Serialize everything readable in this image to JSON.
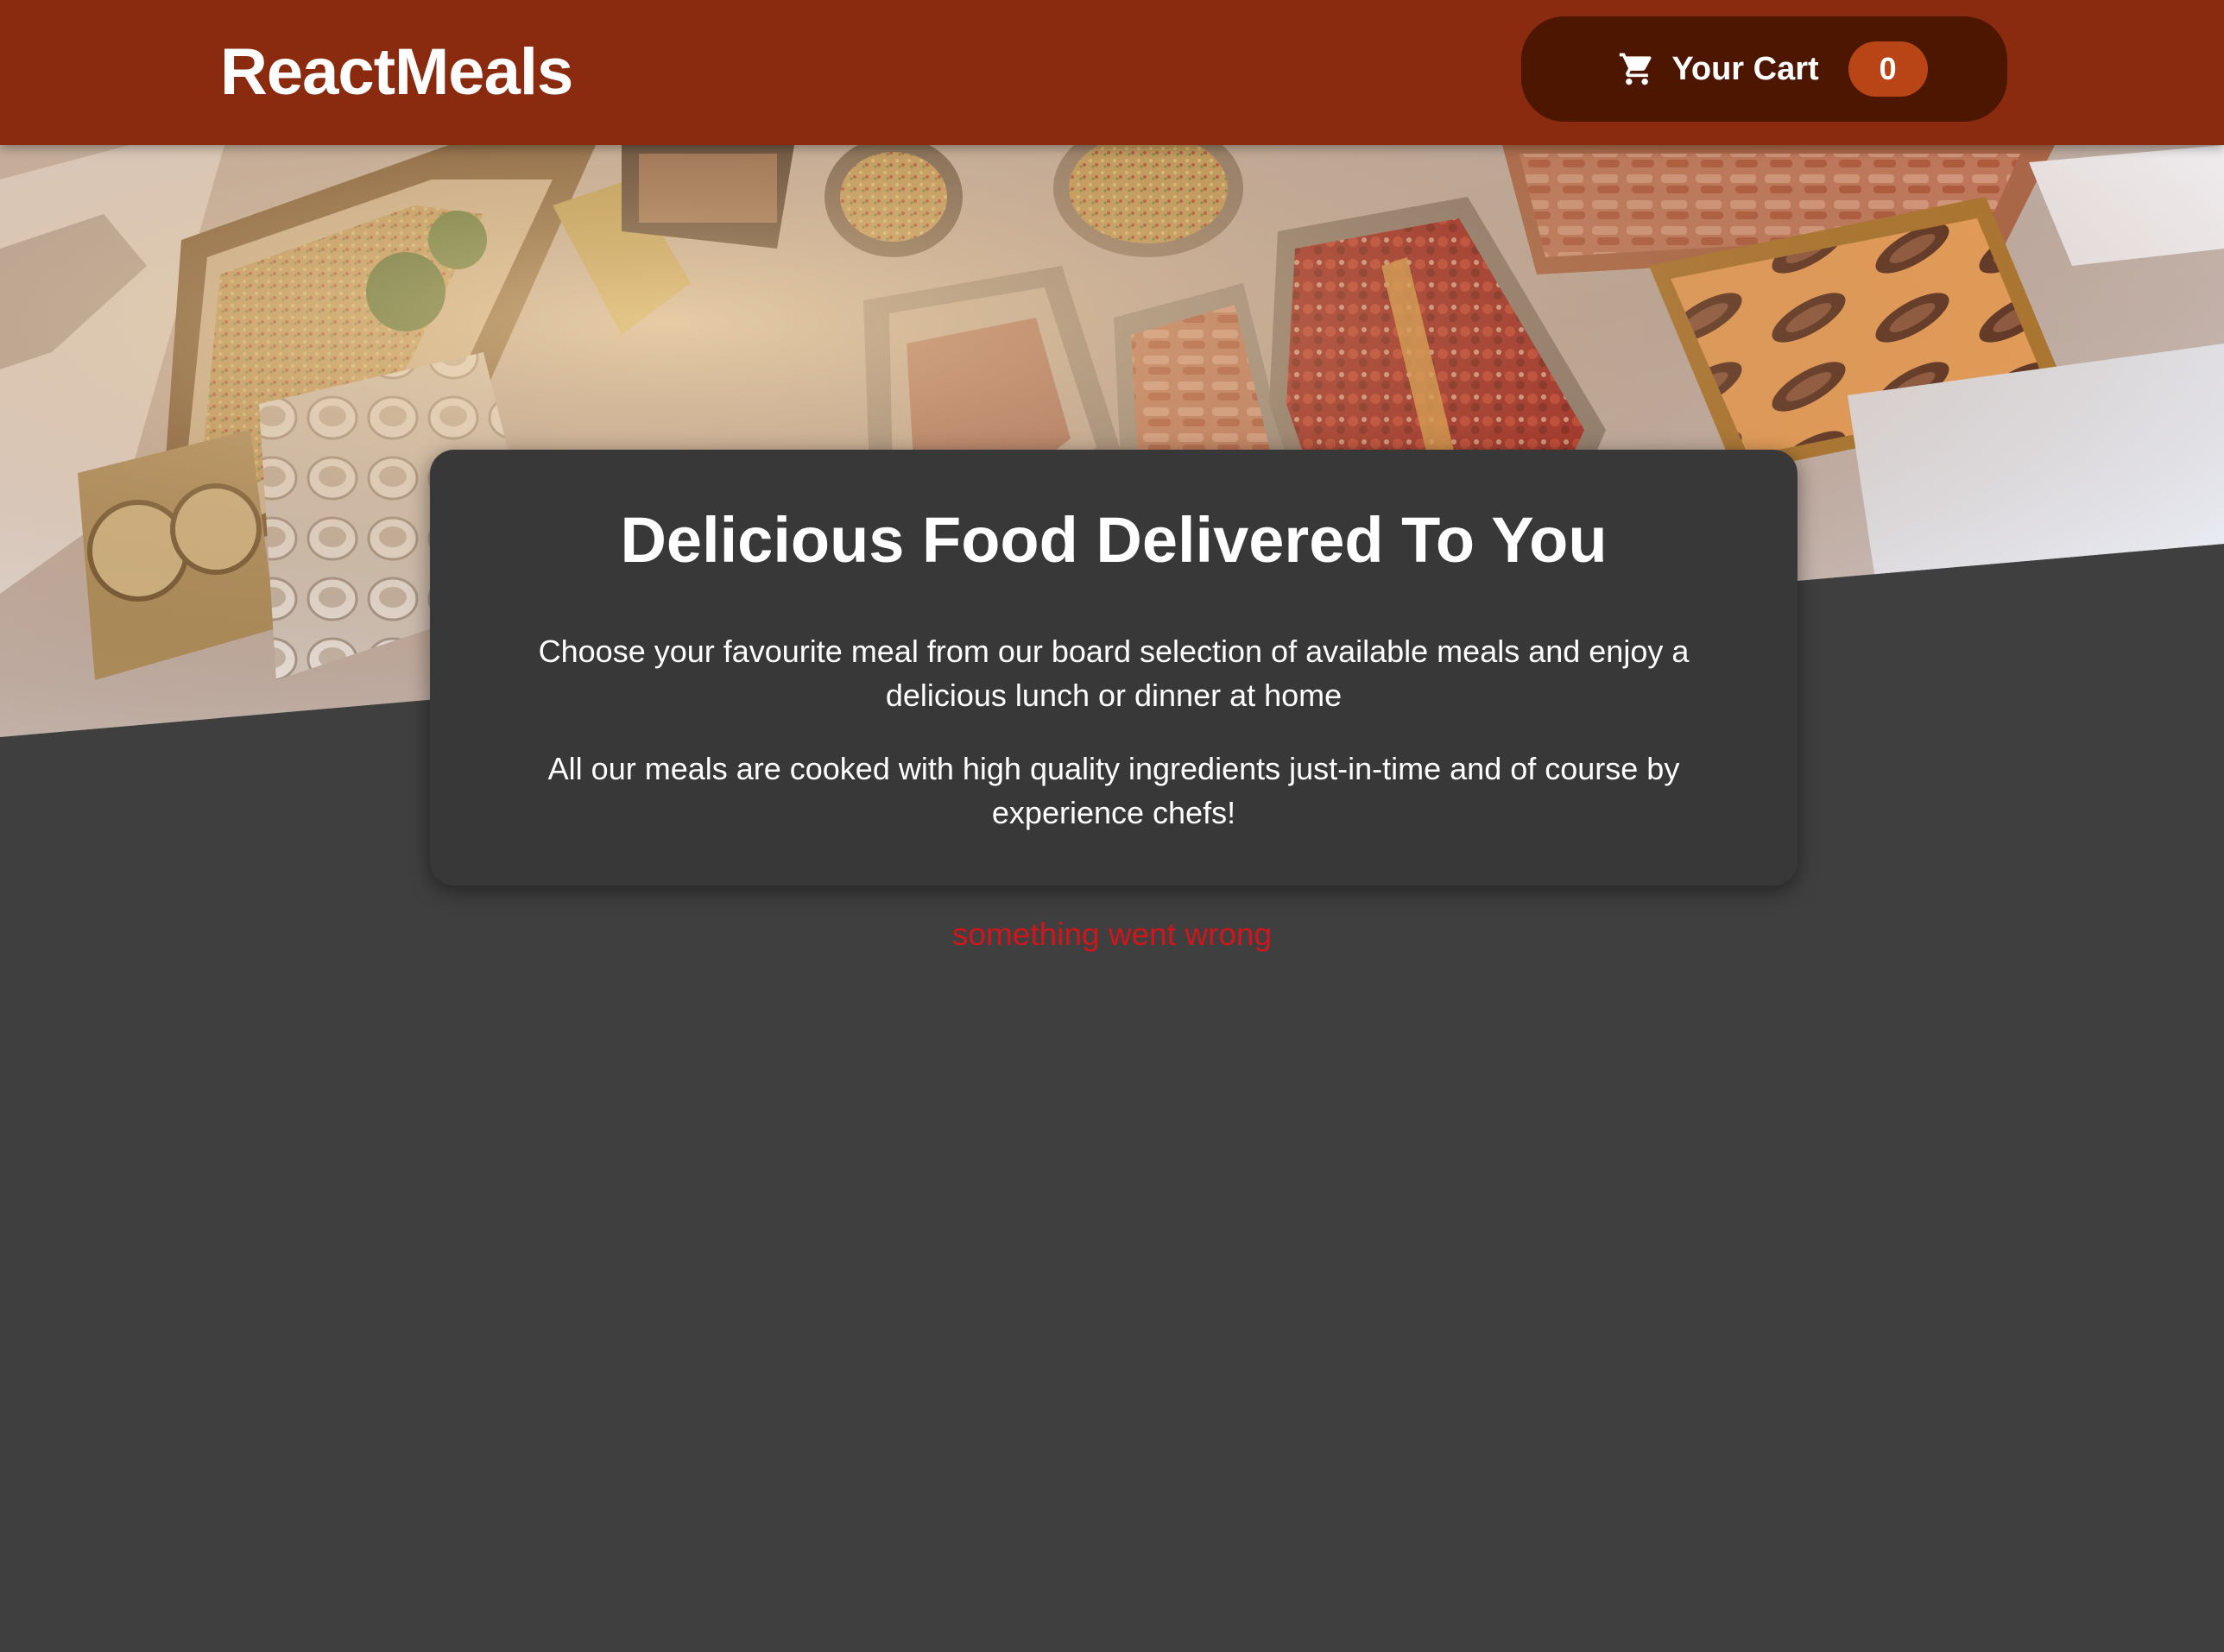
{
  "header": {
    "brand": "ReactMeals",
    "cart_label": "Your Cart",
    "cart_count": "0",
    "cart_icon": "cart-icon"
  },
  "summary": {
    "title": "Delicious Food Delivered To You",
    "paragraph1": "Choose your favourite meal from our board selection of available meals and enjoy a delicious lunch or dinner at home",
    "paragraph2": "All our meals are cooked with high quality ingredients just-in-time and of course by experience chefs!"
  },
  "status": {
    "error": "something went wrong"
  },
  "colors": {
    "header_bg": "#8a2b10",
    "cart_button_bg": "#4d1601",
    "badge_bg": "#b94517",
    "page_bg": "#3f3f3f",
    "card_bg": "#383838",
    "error": "#d0161b"
  }
}
